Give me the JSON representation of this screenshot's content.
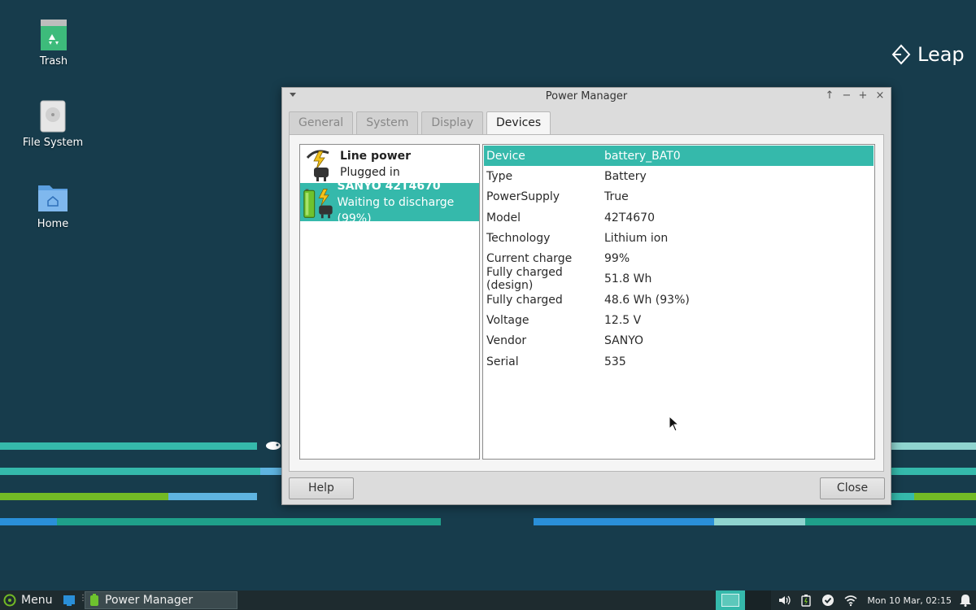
{
  "desktop": {
    "icons": [
      {
        "label": "Trash"
      },
      {
        "label": "File System"
      },
      {
        "label": "Home"
      }
    ],
    "brand": "Leap"
  },
  "window": {
    "title": "Power Manager",
    "tabs": [
      {
        "label": "General"
      },
      {
        "label": "System"
      },
      {
        "label": "Display"
      },
      {
        "label": "Devices"
      }
    ],
    "devices": [
      {
        "name": "Line power",
        "status": "Plugged in"
      },
      {
        "name": "SANYO 42T4670",
        "status": "Waiting to discharge (99%)"
      }
    ],
    "properties": [
      {
        "key": "Device",
        "value": "battery_BAT0"
      },
      {
        "key": "Type",
        "value": "Battery"
      },
      {
        "key": "PowerSupply",
        "value": "True"
      },
      {
        "key": "Model",
        "value": "42T4670"
      },
      {
        "key": "Technology",
        "value": "Lithium ion"
      },
      {
        "key": "Current charge",
        "value": "99%"
      },
      {
        "key": "Fully charged (design)",
        "value": "51.8 Wh"
      },
      {
        "key": "Fully charged",
        "value": "48.6 Wh (93%)"
      },
      {
        "key": "Voltage",
        "value": "12.5 V"
      },
      {
        "key": "Vendor",
        "value": "SANYO"
      },
      {
        "key": "Serial",
        "value": "535"
      }
    ],
    "buttons": {
      "help": "Help",
      "close": "Close"
    }
  },
  "taskbar": {
    "menu_label": "Menu",
    "task_label": "Power Manager",
    "clock": "Mon 10 Mar, 02:15"
  },
  "colors": {
    "selection": "#35b9ab",
    "desktop": "#173c4c"
  }
}
